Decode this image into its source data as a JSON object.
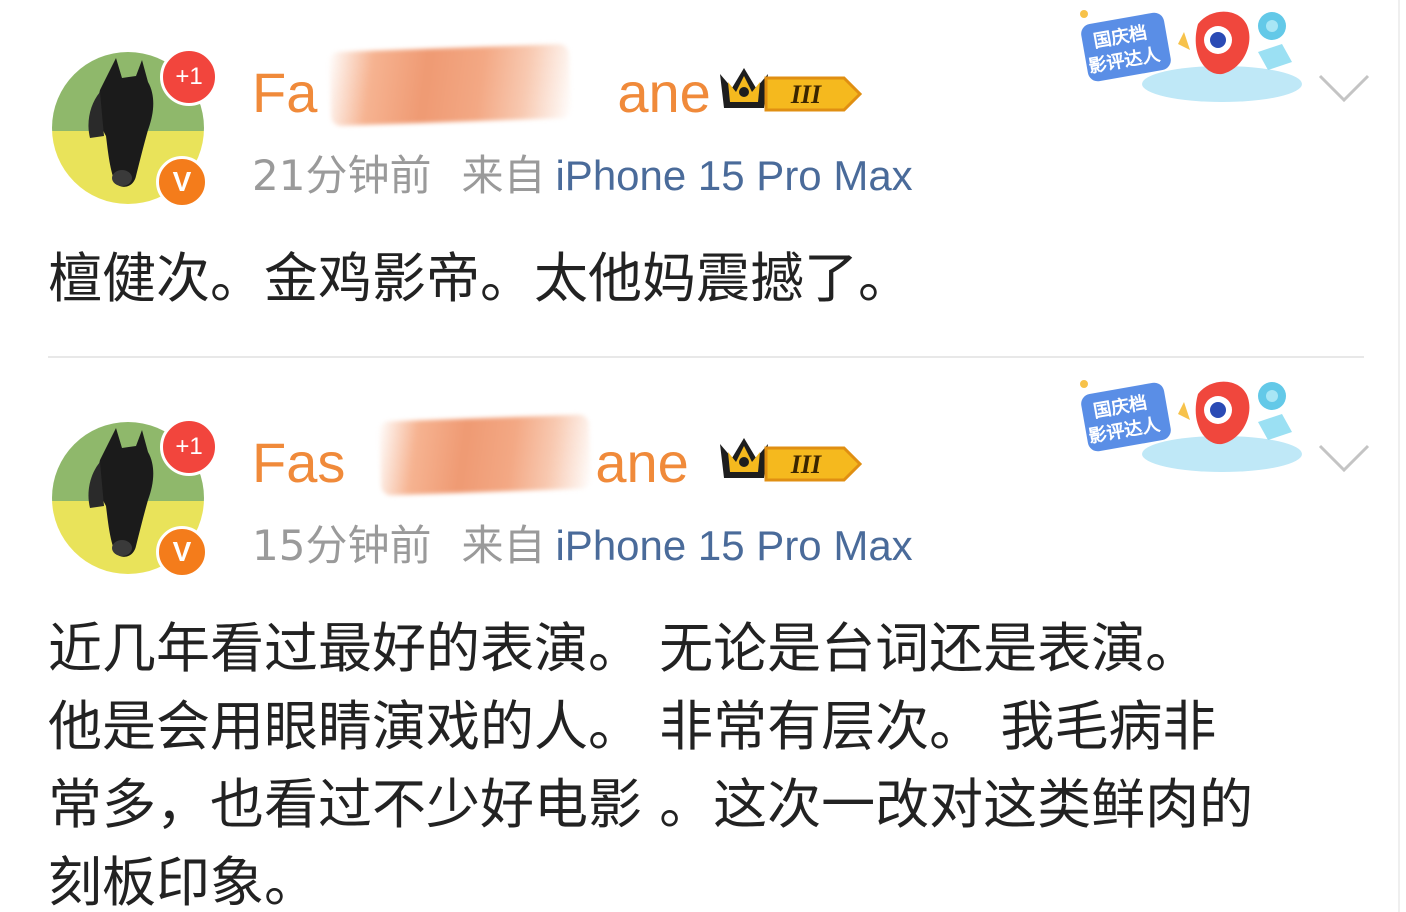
{
  "posts": [
    {
      "avatar_badge": "+1",
      "verified_badge": "V",
      "username": "Fashio**ane",
      "username_visible_start": "Fa",
      "username_visible_end": "ane",
      "level": "III",
      "time": "21分钟前",
      "from_label": "来自",
      "device": "iPhone 15 Pro Max",
      "content": "檀健次。金鸡影帝。太他妈震撼了。",
      "event_badge": {
        "line1": "国庆档",
        "line2": "影评达人"
      }
    },
    {
      "avatar_badge": "+1",
      "verified_badge": "V",
      "username": "Fas**ane",
      "username_visible_start": "Fas",
      "username_visible_end": "ane",
      "level": "III",
      "time": "15分钟前",
      "from_label": "来自",
      "device": "iPhone 15 Pro Max",
      "content": "近几年看过最好的表演。 无论是台词还是表演。\n他是会用眼睛演戏的人。 非常有层次。 我毛病非\n常多，也看过不少好电影 。这次一改对这类鲜肉的\n刻板印象。",
      "event_badge": {
        "line1": "国庆档",
        "line2": "影评达人"
      }
    }
  ],
  "colors": {
    "username": "#f08a3a",
    "device_link": "#4a6b9a",
    "meta_gray": "#9a9a9a",
    "badge_red": "#f2453d",
    "vip_orange": "#f47c1b",
    "crown_gold": "#f5b91e"
  },
  "icons": {
    "chevron": "chevron-down-icon",
    "crown": "crown-level-icon",
    "event": "event-badge-icon"
  }
}
